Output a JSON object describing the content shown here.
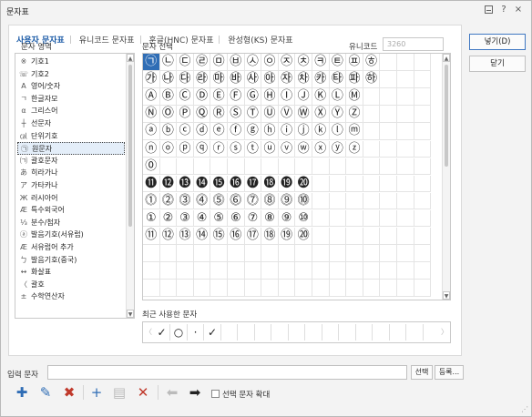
{
  "window": {
    "title": "문자표",
    "help": "?",
    "close": "×"
  },
  "tabs": [
    "사용자 문자표",
    "유니코드 문자표",
    "훈글(HNC) 문자표",
    "완성형(KS) 문자표"
  ],
  "labels": {
    "area": "문자 영역",
    "select": "문자 선택",
    "unicode": "유니코드",
    "recent": "최근 사용한 문자",
    "input": "입력 문자",
    "enlarge": "선택 문자 확대"
  },
  "unicode_value": "3260",
  "categories": [
    {
      "icon": "※",
      "label": "기호1"
    },
    {
      "icon": "☏",
      "label": "기호2"
    },
    {
      "icon": "A",
      "label": "영어/숫자"
    },
    {
      "icon": "ㄱ",
      "label": "한글자모"
    },
    {
      "icon": "α",
      "label": "그리스어"
    },
    {
      "icon": "┼",
      "label": "선문자"
    },
    {
      "icon": "㎈",
      "label": "단위기호"
    },
    {
      "icon": "㉠",
      "label": "원문자"
    },
    {
      "icon": "㈀",
      "label": "괄호문자"
    },
    {
      "icon": "あ",
      "label": "히라가나"
    },
    {
      "icon": "ア",
      "label": "가타카나"
    },
    {
      "icon": "Ж",
      "label": "러시아어"
    },
    {
      "icon": "Æ",
      "label": "특수외국어"
    },
    {
      "icon": "⅓",
      "label": "분수/첨자"
    },
    {
      "icon": "ⓐ",
      "label": "발음기호(서유럽)"
    },
    {
      "icon": "Æ",
      "label": "서유럽어 추가"
    },
    {
      "icon": "ㄅ",
      "label": "발음기호(중국)"
    },
    {
      "icon": "↔",
      "label": "화살표"
    },
    {
      "icon": "〈",
      "label": "괄호"
    },
    {
      "icon": "±",
      "label": "수학연산자"
    }
  ],
  "selected_category": 7,
  "chars": [
    [
      "㉠",
      "㉡",
      "㉢",
      "㉣",
      "㉤",
      "㉥",
      "㉦",
      "㉧",
      "㉨",
      "㉩",
      "㉪",
      "㉫",
      "㉬",
      "㉭"
    ],
    [
      "㉮",
      "㉯",
      "㉰",
      "㉱",
      "㉲",
      "㉳",
      "㉴",
      "㉵",
      "㉶",
      "㉷",
      "㉸",
      "㉹",
      "㉺",
      "㉻"
    ],
    [
      "Ⓐ",
      "Ⓑ",
      "Ⓒ",
      "Ⓓ",
      "Ⓔ",
      "Ⓕ",
      "Ⓖ",
      "Ⓗ",
      "Ⓘ",
      "Ⓙ",
      "Ⓚ",
      "Ⓛ",
      "Ⓜ"
    ],
    [
      "Ⓝ",
      "Ⓞ",
      "Ⓟ",
      "Ⓠ",
      "Ⓡ",
      "Ⓢ",
      "Ⓣ",
      "Ⓤ",
      "Ⓥ",
      "Ⓦ",
      "Ⓧ",
      "Ⓨ",
      "Ⓩ"
    ],
    [
      "ⓐ",
      "ⓑ",
      "ⓒ",
      "ⓓ",
      "ⓔ",
      "ⓕ",
      "ⓖ",
      "ⓗ",
      "ⓘ",
      "ⓙ",
      "ⓚ",
      "ⓛ",
      "ⓜ"
    ],
    [
      "ⓝ",
      "ⓞ",
      "ⓟ",
      "ⓠ",
      "ⓡ",
      "ⓢ",
      "ⓣ",
      "ⓤ",
      "ⓥ",
      "ⓦ",
      "ⓧ",
      "ⓨ",
      "ⓩ"
    ],
    [
      "⓪"
    ],
    [
      "⓫",
      "⓬",
      "⓭",
      "⓮",
      "⓯",
      "⓰",
      "⓱",
      "⓲",
      "⓳",
      "⓴"
    ],
    [
      "⓵",
      "⓶",
      "⓷",
      "⓸",
      "⓹",
      "⓺",
      "⓻",
      "⓼",
      "⓽",
      "⓾"
    ],
    [
      "①",
      "②",
      "③",
      "④",
      "⑤",
      "⑥",
      "⑦",
      "⑧",
      "⑨",
      "⑩"
    ],
    [
      "⑪",
      "⑫",
      "⑬",
      "⑭",
      "⑮",
      "⑯",
      "⑰",
      "⑱",
      "⑲",
      "⑳"
    ]
  ],
  "recent_chars": [
    "✓",
    "○",
    "·",
    "✓"
  ],
  "buttons": {
    "insert": "넣기(D)",
    "close": "닫기",
    "select": "선택",
    "register": "등록..."
  }
}
